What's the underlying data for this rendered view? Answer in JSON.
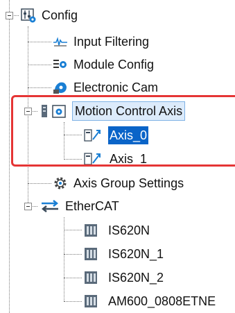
{
  "tree": {
    "root": {
      "label": "Config",
      "icon": "config-icon"
    },
    "items": [
      {
        "label": "Input Filtering",
        "icon": "waveform-icon"
      },
      {
        "label": "Module Config",
        "icon": "module-config-icon"
      },
      {
        "label": "Electronic Cam",
        "icon": "cam-icon"
      },
      {
        "label": "Motion Control Axis",
        "icon": "motion-control-icon",
        "children": [
          {
            "label": "Axis_0",
            "icon": "axis-icon",
            "selected": true
          },
          {
            "label": "Axis_1",
            "icon": "axis-icon"
          }
        ]
      },
      {
        "label": "Axis Group Settings",
        "icon": "gear-icon"
      },
      {
        "label": "EtherCAT",
        "icon": "ethercat-icon",
        "children": [
          {
            "label": "IS620N",
            "icon": "servo-drive-icon"
          },
          {
            "label": "IS620N_1",
            "icon": "servo-drive-icon"
          },
          {
            "label": "IS620N_2",
            "icon": "servo-drive-icon"
          },
          {
            "label": "AM600_0808ETNE",
            "icon": "io-module-icon"
          }
        ]
      }
    ]
  },
  "colors": {
    "selection": "#0a64c8",
    "hover": "#dcebfb",
    "annotation": "#e53535"
  }
}
